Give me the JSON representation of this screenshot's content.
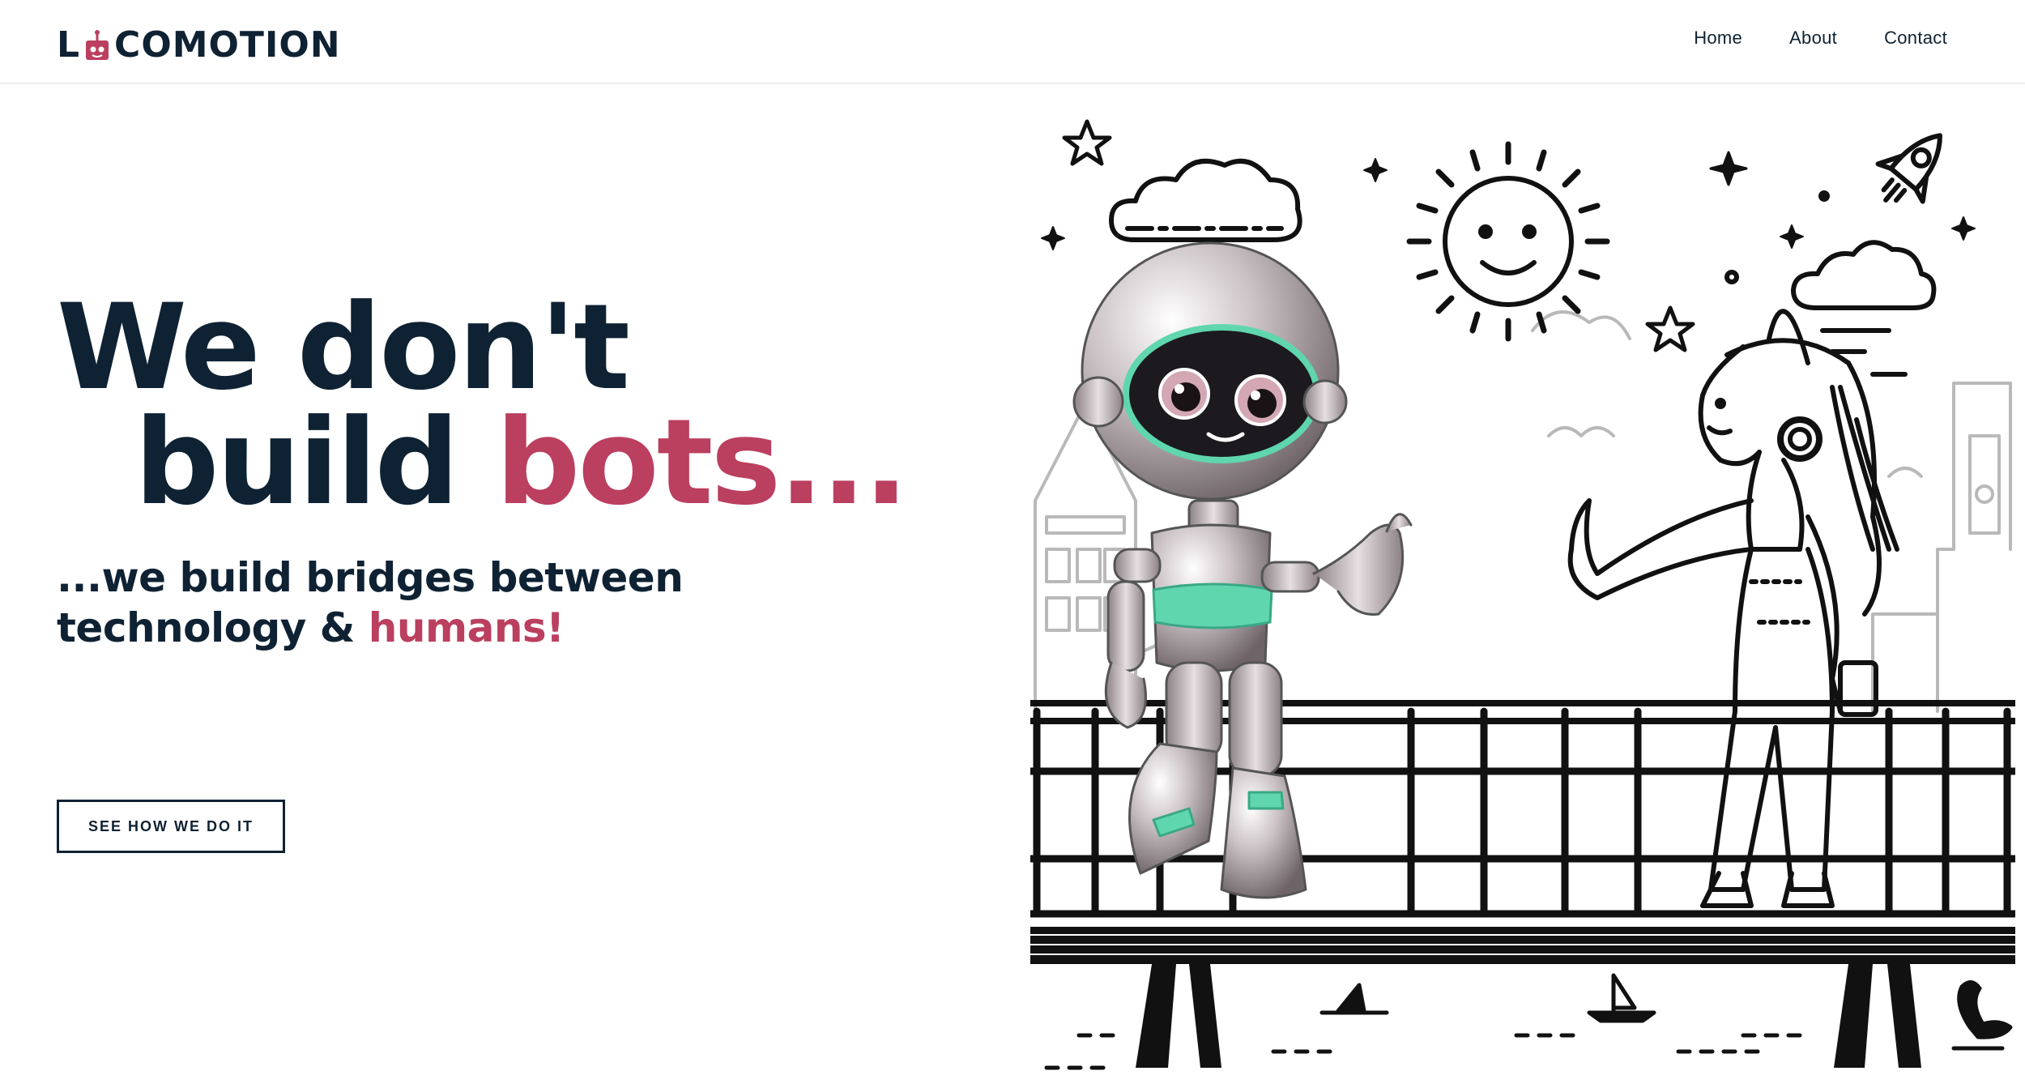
{
  "brand": {
    "name_prefix": "L",
    "name_suffix": "COMOTION"
  },
  "nav": {
    "items": [
      "Home",
      "About",
      "Contact"
    ]
  },
  "hero": {
    "title_line1": "We don't",
    "title_line2_a": "build ",
    "title_line2_b": "bots...",
    "subtitle_line1": "...we build bridges between",
    "subtitle_line2_a": "technology & ",
    "subtitle_line2_b": "humans!",
    "cta_label": "SEE HOW WE DO IT"
  },
  "colors": {
    "accent": "#bb3f5f",
    "ink": "#0f2233",
    "robot_teal": "#5fd6ae"
  },
  "illustration": {
    "icons": [
      "star-icon",
      "cloud-icon",
      "sun-icon",
      "rocket-icon",
      "swan-icon",
      "sailboat-icon",
      "shark-fin-icon"
    ],
    "subjects": [
      "robot",
      "girl-with-headphones",
      "bridge-railing",
      "city-skyline"
    ]
  }
}
